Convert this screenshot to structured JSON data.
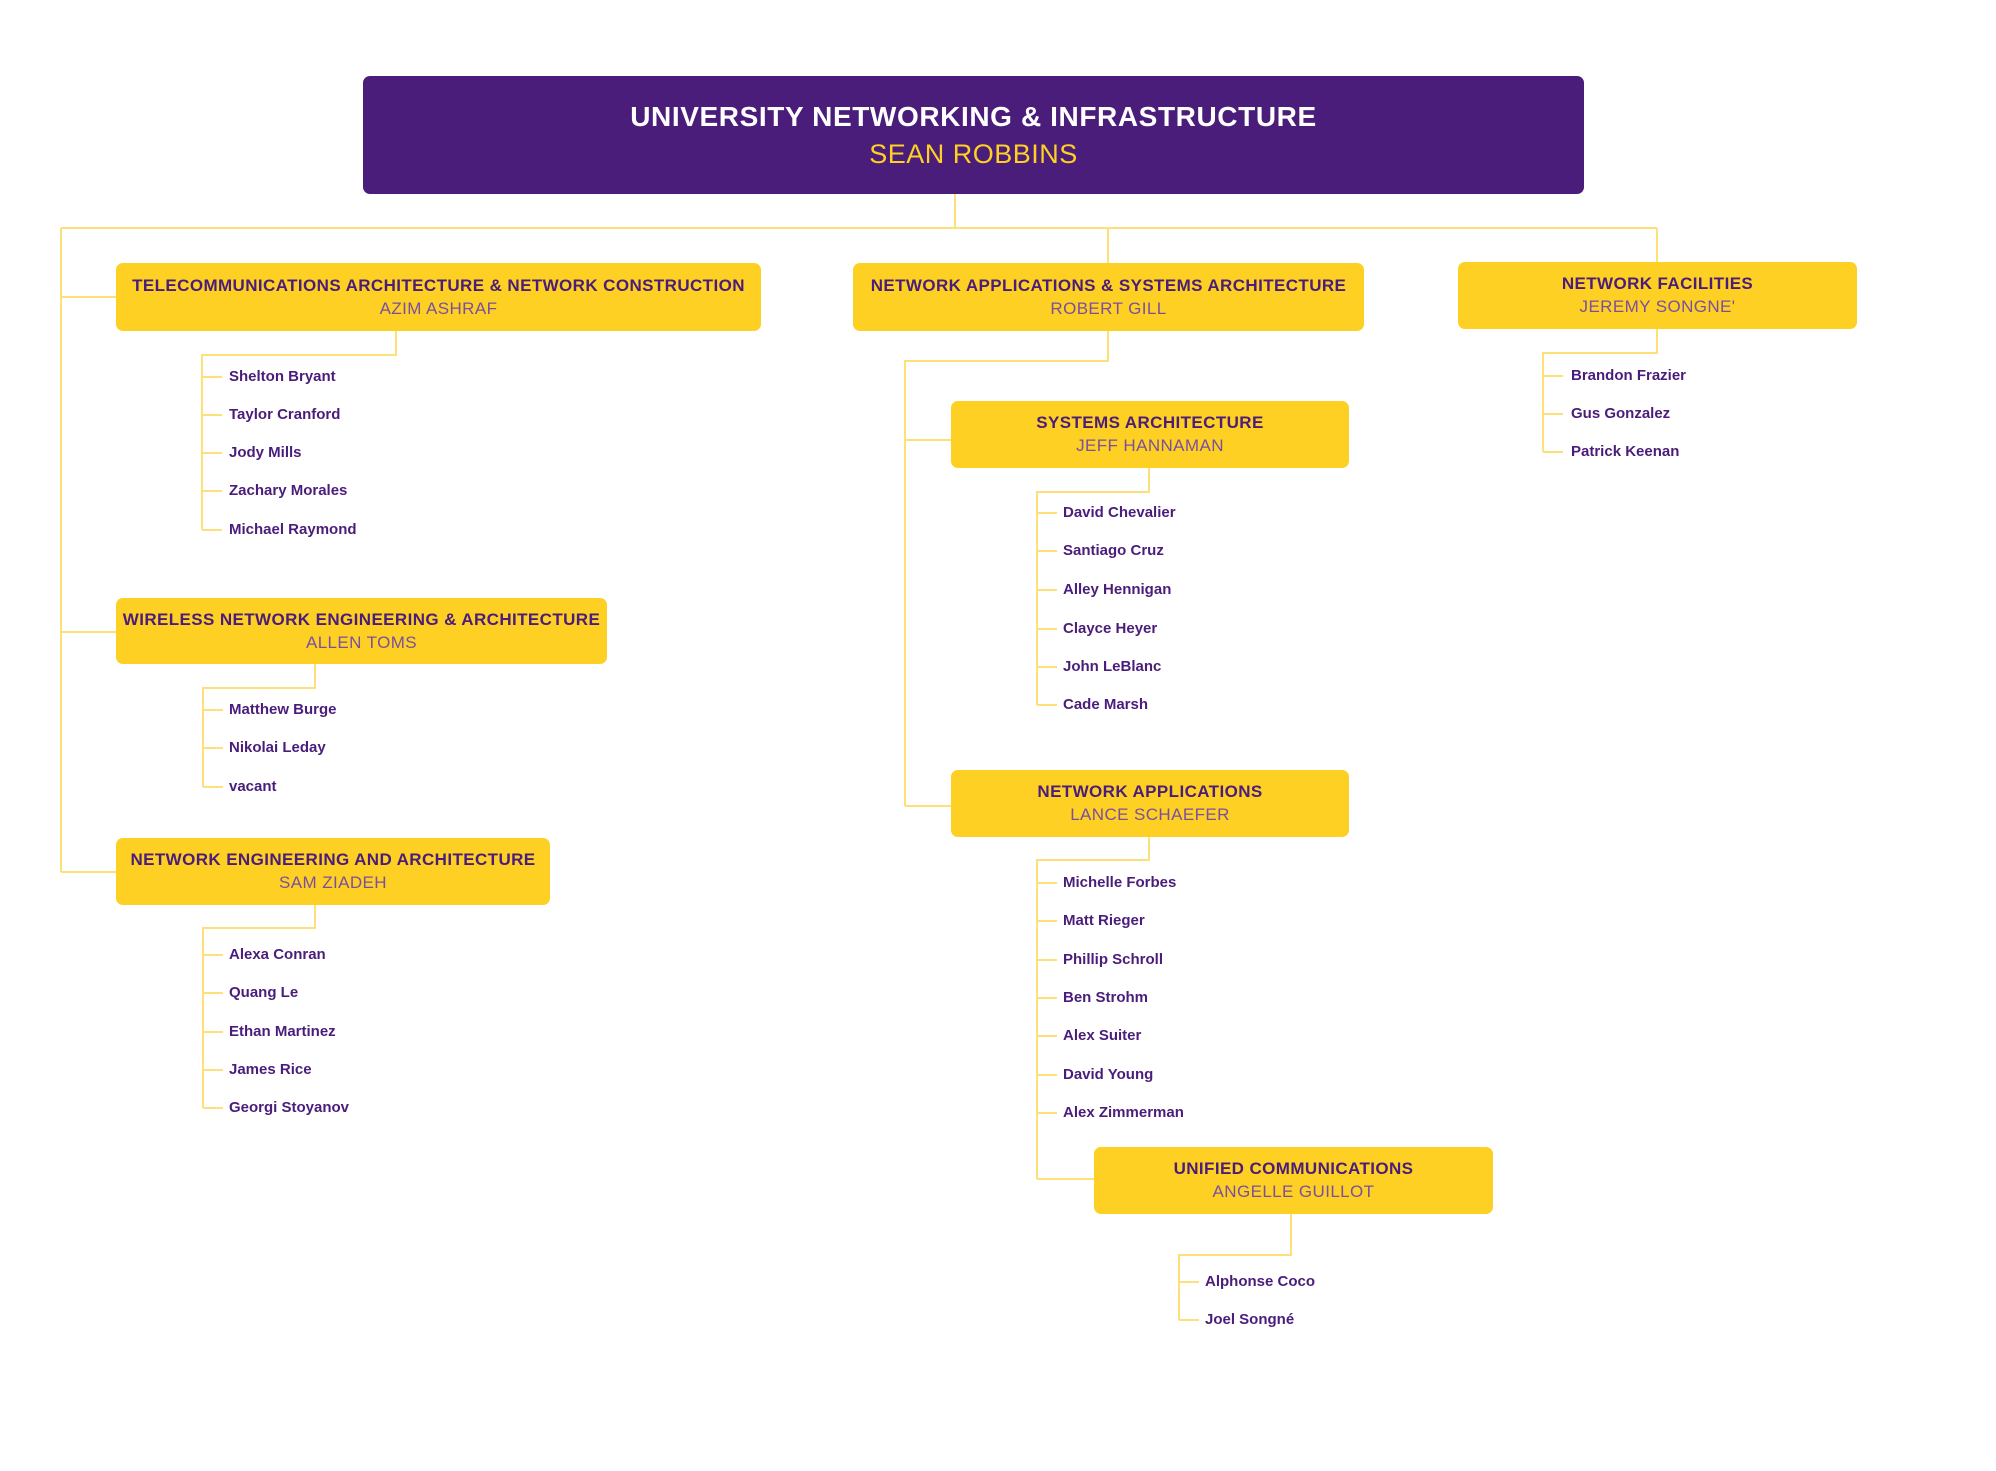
{
  "colors": {
    "primary_purple": "#4a1d7a",
    "accent_gold": "#fdd023",
    "subtitle_purple": "#7a4fa0",
    "connector_line": "#fde07a"
  },
  "root": {
    "title": "UNIVERSITY NETWORKING & INFRASTRUCTURE",
    "head": "SEAN ROBBINS"
  },
  "departments": {
    "telecom": {
      "title": "TELECOMMUNICATIONS ARCHITECTURE & NETWORK CONSTRUCTION",
      "head": "AZIM ASHRAF",
      "members": [
        "Shelton Bryant",
        "Taylor Cranford",
        "Jody Mills",
        "Zachary Morales",
        "Michael Raymond"
      ]
    },
    "wireless": {
      "title": "WIRELESS NETWORK ENGINEERING & ARCHITECTURE",
      "head": "ALLEN TOMS",
      "members": [
        "Matthew Burge",
        "Nikolai Leday",
        "vacant"
      ]
    },
    "network_eng": {
      "title": "NETWORK ENGINEERING AND ARCHITECTURE",
      "head": "SAM ZIADEH",
      "members": [
        "Alexa Conran",
        "Quang Le",
        "Ethan Martinez",
        "James Rice",
        "Georgi Stoyanov"
      ]
    },
    "netapps_sysarch": {
      "title": "NETWORK APPLICATIONS & SYSTEMS ARCHITECTURE",
      "head": "ROBERT GILL"
    },
    "systems_arch": {
      "title": "SYSTEMS ARCHITECTURE",
      "head": "JEFF HANNAMAN",
      "members": [
        "David Chevalier",
        "Santiago Cruz",
        "Alley Hennigan",
        "Clayce Heyer",
        "John LeBlanc",
        "Cade Marsh"
      ]
    },
    "network_apps": {
      "title": "NETWORK APPLICATIONS",
      "head": "LANCE SCHAEFER",
      "members": [
        "Michelle Forbes",
        "Matt Rieger",
        "Phillip Schroll",
        "Ben Strohm",
        "Alex Suiter",
        "David Young",
        "Alex Zimmerman"
      ]
    },
    "unified_comm": {
      "title": "UNIFIED COMMUNICATIONS",
      "head": "ANGELLE GUILLOT",
      "members": [
        "Alphonse Coco",
        "Joel Songné"
      ]
    },
    "facilities": {
      "title": "NETWORK FACILITIES",
      "head": "JEREMY SONGNE'",
      "members": [
        "Brandon Frazier",
        "Gus Gonzalez",
        "Patrick Keenan"
      ]
    }
  }
}
